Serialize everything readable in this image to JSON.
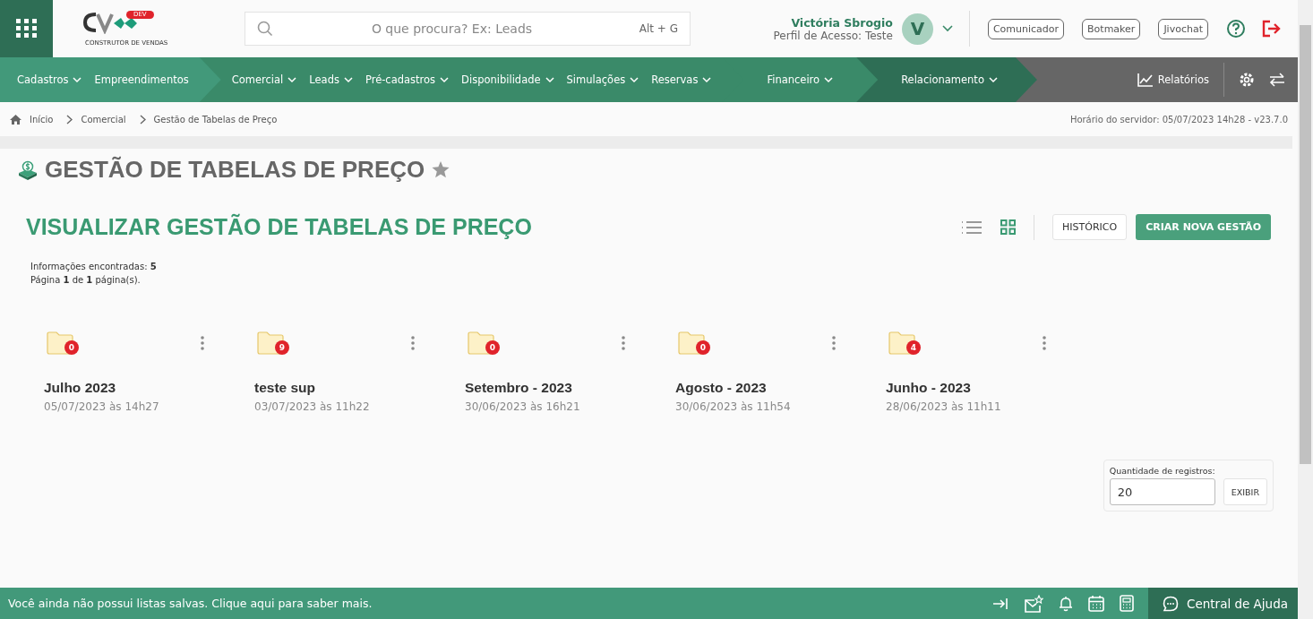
{
  "header": {
    "search": {
      "placeholder": "O que procura? Ex: Leads",
      "shortcut": "Alt + G"
    },
    "logo": {
      "badge": "DEV",
      "tagline": "CONSTRUTOR DE VENDAS"
    },
    "user": {
      "name": "Victória Sbrogio",
      "profile": "Perfil de Acesso: Teste",
      "initial": "V"
    },
    "buttons": [
      "Comunicador",
      "Botmaker",
      "Jivochat"
    ]
  },
  "nav": {
    "groups": [
      {
        "items": [
          {
            "label": "Cadastros",
            "dropdown": true
          },
          {
            "label": "Empreendimentos",
            "dropdown": false
          }
        ]
      },
      {
        "items": [
          {
            "label": "Comercial",
            "dropdown": true
          },
          {
            "label": "Leads",
            "dropdown": true
          },
          {
            "label": "Pré-cadastros",
            "dropdown": true
          },
          {
            "label": "Disponibilidade",
            "dropdown": true
          },
          {
            "label": "Simulações",
            "dropdown": true
          },
          {
            "label": "Reservas",
            "dropdown": true
          }
        ]
      },
      {
        "items": [
          {
            "label": "Financeiro",
            "dropdown": true
          }
        ]
      },
      {
        "items": [
          {
            "label": "Relacionamento",
            "dropdown": true
          }
        ]
      }
    ],
    "reports": "Relatórios"
  },
  "breadcrumb": [
    "Início",
    "Comercial",
    "Gestão de Tabelas de Preço"
  ],
  "server_time": "Horário do servidor: 05/07/2023 14h28 - v23.7.0",
  "page_title": "GESTÃO DE TABELAS DE PREÇO",
  "favorite": false,
  "section_title": "VISUALIZAR GESTÃO DE TABELAS DE PREÇO",
  "view_modes": [
    {
      "kind": "list",
      "selected": false
    },
    {
      "kind": "grid",
      "selected": true
    }
  ],
  "actions": [
    "HISTÓRICO",
    "CRIAR NOVA GESTÃO"
  ],
  "summary": [
    "Informações encontradas: **5**",
    "Página **1** de **1** página(s)."
  ],
  "folders": [
    {
      "name": "Julho 2023",
      "date": "05/07/2023 às 14h27",
      "count": "0"
    },
    {
      "name": "teste sup",
      "date": "03/07/2023 às 11h22",
      "count": "9"
    },
    {
      "name": "Setembro - 2023",
      "date": "30/06/2023 às 16h21",
      "count": "0"
    },
    {
      "name": "Agosto - 2023",
      "date": "30/06/2023 às 11h54",
      "count": "0"
    },
    {
      "name": "Junho - 2023",
      "date": "28/06/2023 às 11h11",
      "count": "4"
    }
  ],
  "records": {
    "label": "Quantidade de registros:",
    "value": "20",
    "button": "EXIBIR"
  },
  "footer": {
    "message": "Você ainda não possui listas salvas. Clique aqui para saber mais.",
    "help": "Central de Ajuda"
  }
}
